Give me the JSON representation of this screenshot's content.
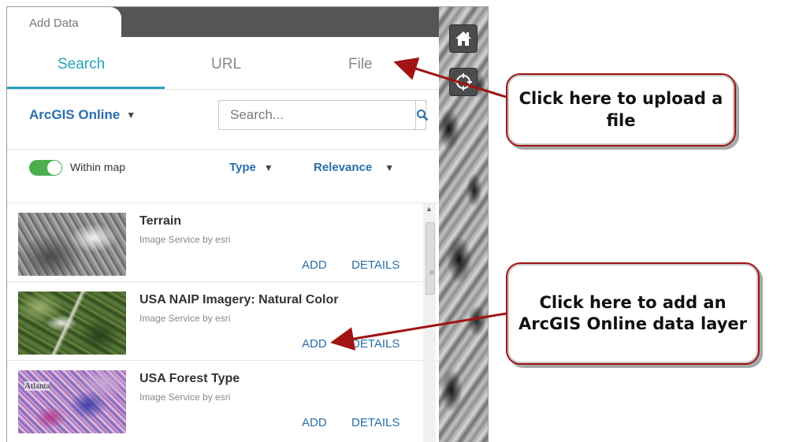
{
  "panel": {
    "title": "Add Data",
    "tabs": [
      {
        "label": "Search",
        "active": true
      },
      {
        "label": "URL",
        "active": false
      },
      {
        "label": "File",
        "active": false
      }
    ],
    "source_label": "ArcGIS Online",
    "search": {
      "placeholder": "Search..."
    },
    "within_map_label": "Within map",
    "within_map_on": true,
    "filters": {
      "type_label": "Type",
      "sort_label": "Relevance"
    }
  },
  "results": [
    {
      "title": "Terrain",
      "subtitle": "Image Service by esri",
      "add": "ADD",
      "details": "DETAILS",
      "thumb": "terrain"
    },
    {
      "title": "USA NAIP Imagery: Natural Color",
      "subtitle": "Image Service by esri",
      "add": "ADD",
      "details": "DETAILS",
      "thumb": "imagery"
    },
    {
      "title": "USA Forest Type",
      "subtitle": "Image Service by esri",
      "add": "ADD",
      "details": "DETAILS",
      "thumb": "forest",
      "thumb_label": "Atlanta"
    }
  ],
  "map_controls": [
    {
      "icon": "home-icon"
    },
    {
      "icon": "locate-icon"
    }
  ],
  "callouts": {
    "upload": "Click here to upload a file",
    "add_layer": "Click here to add an ArcGIS Online data layer"
  },
  "colors": {
    "accent": "#24a4b8",
    "link": "#2a6ea9",
    "toggle": "#4cae4c",
    "callout_border": "#a01414"
  }
}
